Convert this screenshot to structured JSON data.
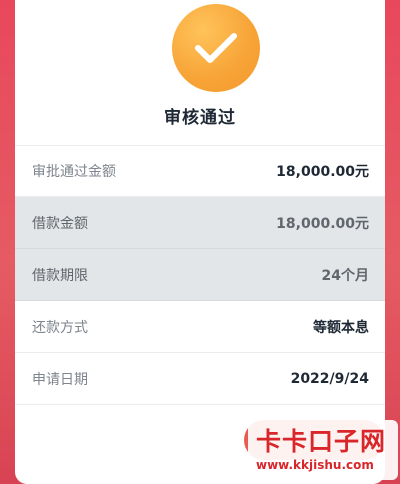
{
  "header": {
    "status_title": "审核通过",
    "icon": "check-icon",
    "accent_color": "#f7a336"
  },
  "details": [
    {
      "label": "审批通过金额",
      "value": "18,000.00元"
    },
    {
      "label": "借款金额",
      "value": "18,000.00元"
    },
    {
      "label": "借款期限",
      "value": "24个月"
    },
    {
      "label": "还款方式",
      "value": "等额本息"
    },
    {
      "label": "申请日期",
      "value": "2022/9/24"
    }
  ],
  "watermark": {
    "title": "卡卡口子网",
    "url": "www.kkjishu.com"
  },
  "colors": {
    "background": "#e8485c",
    "watermark": "#d9262a"
  }
}
